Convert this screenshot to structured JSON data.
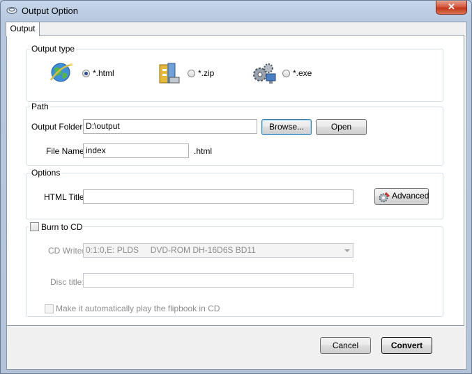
{
  "window": {
    "title": "Output Option",
    "close_glyph": "✕"
  },
  "tabs": [
    {
      "label": "Output",
      "selected": true
    }
  ],
  "output_type": {
    "legend": "Output type",
    "options": [
      {
        "label": "*.html",
        "icon": "globe-icon",
        "checked": true
      },
      {
        "label": "*.zip",
        "icon": "zip-archive-icon",
        "checked": false
      },
      {
        "label": "*.exe",
        "icon": "gears-exe-icon",
        "checked": false
      }
    ]
  },
  "path": {
    "legend": "Path",
    "output_folder_label": "Output Folder:",
    "output_folder_value": "D:\\output",
    "browse_label": "Browse...",
    "open_label": "Open",
    "file_name_label": "File Name:",
    "file_name_value": "index",
    "extension": ".html"
  },
  "options": {
    "legend": "Options",
    "html_title_label": "HTML Title:",
    "html_title_value": "",
    "advanced_label": "Advanced"
  },
  "burn": {
    "checkbox_label": "Burn to CD",
    "checked": false,
    "cd_writer_label": "CD Writer",
    "cd_writer_value": "0:1:0,E: PLDS     DVD-ROM DH-16D6S BD11",
    "disc_title_label": "Disc title:",
    "disc_title_value": "",
    "autoplay_label": "Make it automatically play the flipbook in CD"
  },
  "footer": {
    "cancel_label": "Cancel",
    "convert_label": "Convert"
  }
}
